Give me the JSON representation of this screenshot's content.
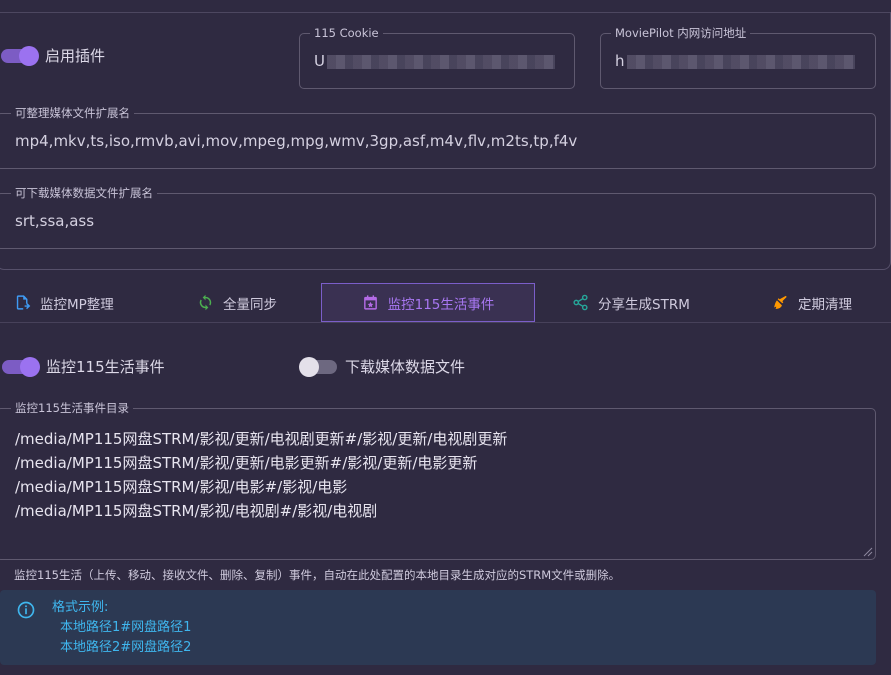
{
  "plugin": {
    "enable_label": "启用插件",
    "enabled": true
  },
  "cookie_field": {
    "label": "115 Cookie",
    "value_visible": "U"
  },
  "moviepilot_field": {
    "label": "MoviePilot 内网访问地址",
    "value_visible": "h"
  },
  "media_ext": {
    "label": "可整理媒体文件扩展名",
    "value": "mp4,mkv,ts,iso,rmvb,avi,mov,mpeg,mpg,wmv,3gp,asf,m4v,flv,m2ts,tp,f4v"
  },
  "download_ext": {
    "label": "可下载媒体数据文件扩展名",
    "value": "srt,ssa,ass"
  },
  "tabs": [
    {
      "label": "监控MP整理",
      "icon": "file-export-icon",
      "active": false
    },
    {
      "label": "全量同步",
      "icon": "sync-icon",
      "active": false
    },
    {
      "label": "监控115生活事件",
      "icon": "calendar-icon",
      "active": true
    },
    {
      "label": "分享生成STRM",
      "icon": "share-icon",
      "active": false
    },
    {
      "label": "定期清理",
      "icon": "broom-icon",
      "active": false
    }
  ],
  "life_events": {
    "toggle_label": "监控115生活事件",
    "toggle_on": true,
    "download_toggle_label": "下载媒体数据文件",
    "download_toggle_on": false,
    "dir_label": "监控115生活事件目录",
    "dir_lines": [
      "/media/MP115网盘STRM/影视/更新/电视剧更新#/影视/更新/电视剧更新",
      "/media/MP115网盘STRM/影视/更新/电影更新#/影视/更新/电影更新",
      "/media/MP115网盘STRM/影视/电影#/影视/电影",
      "/media/MP115网盘STRM/影视/电视剧#/影视/电视剧"
    ],
    "hint": "监控115生活（上传、移动、接收文件、删除、复制）事件，自动在此处配置的本地目录生成对应的STRM文件或删除。"
  },
  "alert": {
    "title": "格式示例:",
    "line1": "本地路径1#网盘路径1",
    "line2": "本地路径2#网盘路径2",
    "icon": "info-icon"
  },
  "colors": {
    "background": "#2f2a41",
    "accent": "#9b72f0",
    "active_tab": "#a877f2",
    "info": "#3fb6ee"
  }
}
